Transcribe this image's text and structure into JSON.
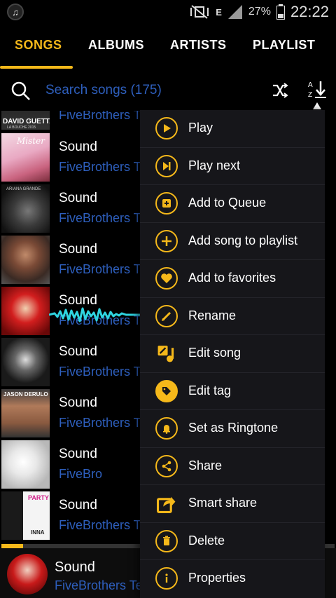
{
  "status_bar": {
    "battery": "27%",
    "time": "22:22",
    "network": "E"
  },
  "tabs": [
    {
      "label": "SONGS",
      "active": true
    },
    {
      "label": "ALBUMS",
      "active": false
    },
    {
      "label": "ARTISTS",
      "active": false
    },
    {
      "label": "PLAYLIST",
      "active": false
    }
  ],
  "search": {
    "placeholder": "Search songs (175)",
    "shuffle_icon": "shuffle-icon",
    "sort_icon": "sort-az-icon"
  },
  "songs": [
    {
      "title": "",
      "subtitle": "FiveBrothers T",
      "art_text": "DAVID GUETTA",
      "art_sub": "LA BOUCHE 2015"
    },
    {
      "title": "Sound",
      "subtitle": "FiveBrothers T",
      "art_text": "Mister",
      "art_sub": ""
    },
    {
      "title": "Sound",
      "subtitle": "FiveBrothers T",
      "art_text": "ARIANA GRANDE",
      "art_sub": ""
    },
    {
      "title": "Sound",
      "subtitle": "FiveBrothers T",
      "art_text": "",
      "art_sub": ""
    },
    {
      "title": "Sound",
      "subtitle": "FiveBrothers T",
      "art_text": "",
      "art_sub": ""
    },
    {
      "title": "Sound",
      "subtitle": "FiveBrothers T",
      "art_text": "",
      "art_sub": ""
    },
    {
      "title": "Sound",
      "subtitle": "FiveBrothers T",
      "art_text": "JASON DERULO",
      "art_sub": ""
    },
    {
      "title": "Sound",
      "subtitle": "FiveBro",
      "art_text": "",
      "art_sub": ""
    },
    {
      "title": "Sound",
      "subtitle": "FiveBrothers T",
      "art_text": "PARTY",
      "art_sub": "INNA"
    }
  ],
  "progress": {
    "fraction": 0.065
  },
  "mini_player": {
    "title": "Sound",
    "subtitle": "FiveBrothers Te"
  },
  "menu": [
    {
      "label": "Play",
      "icon": "play-icon"
    },
    {
      "label": "Play next",
      "icon": "play-next-icon"
    },
    {
      "label": "Add to Queue",
      "icon": "add-queue-icon"
    },
    {
      "label": "Add song to playlist",
      "icon": "plus-icon"
    },
    {
      "label": "Add to favorites",
      "icon": "heart-icon"
    },
    {
      "label": "Rename",
      "icon": "pencil-icon"
    },
    {
      "label": "Edit song",
      "icon": "edit-song-icon"
    },
    {
      "label": "Edit tag",
      "icon": "tag-icon"
    },
    {
      "label": "Set as Ringtone",
      "icon": "bell-icon"
    },
    {
      "label": "Share",
      "icon": "share-icon"
    },
    {
      "label": "Smart share",
      "icon": "smart-share-icon"
    },
    {
      "label": "Delete",
      "icon": "trash-icon"
    },
    {
      "label": "Properties",
      "icon": "info-icon"
    }
  ],
  "colors": {
    "accent": "#f5b81a",
    "link": "#2e5fbd",
    "wave": "#2fd4e0"
  }
}
